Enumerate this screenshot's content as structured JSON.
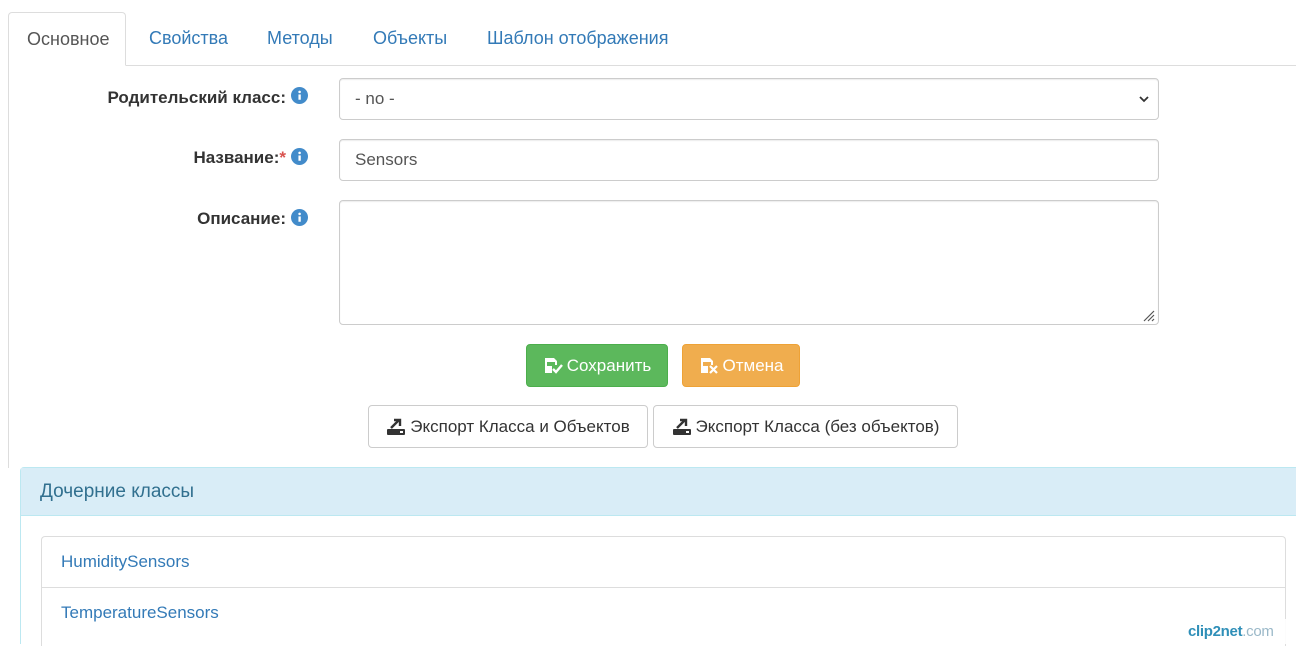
{
  "tabs": [
    {
      "label": "Основное",
      "active": true
    },
    {
      "label": "Свойства",
      "active": false
    },
    {
      "label": "Методы",
      "active": false
    },
    {
      "label": "Объекты",
      "active": false
    },
    {
      "label": "Шаблон отображения",
      "active": false
    }
  ],
  "form": {
    "parent_class": {
      "label": "Родительский класс:",
      "value": "- no -"
    },
    "name": {
      "label": "Название:",
      "required_mark": "*",
      "value": "Sensors"
    },
    "description": {
      "label": "Описание:",
      "value": ""
    }
  },
  "buttons": {
    "save": "Сохранить",
    "cancel": "Отмена",
    "export_with_objects": "Экспорт Класса и Объектов",
    "export_without_objects": "Экспорт Класса (без объектов)"
  },
  "child_classes": {
    "title": "Дочерние классы",
    "items": [
      "HumiditySensors",
      "TemperatureSensors"
    ]
  },
  "watermark": {
    "brand": "clip2net",
    "suffix": ".com"
  },
  "colors": {
    "link": "#337ab7",
    "success": "#5cb85c",
    "warning": "#f0ad4e",
    "info_bg": "#d9edf7",
    "info_text": "#31708f",
    "required": "#d9534f"
  },
  "icons": {
    "label_hint": "info-circle-icon",
    "select_arrow": "chevron-down-icon",
    "save": "save-check-icon",
    "cancel": "save-cancel-icon",
    "export": "export-icon"
  }
}
